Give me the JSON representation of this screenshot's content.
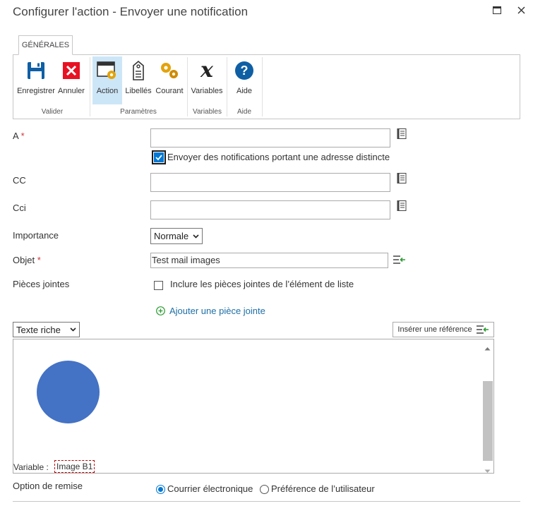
{
  "dialog": {
    "title": "Configurer l'action - Envoyer une notification"
  },
  "ribbon": {
    "tab_label": "GÉNÉRALES",
    "buttons": {
      "save": "Enregistrer",
      "cancel": "Annuler",
      "action": "Action",
      "labels": "Libellés",
      "current": "Courant",
      "variables": "Variables",
      "help": "Aide"
    },
    "groups": {
      "validate": "Valider",
      "parameters": "Paramètres",
      "variables": "Variables",
      "help": "Aide"
    }
  },
  "form": {
    "to_label": "A",
    "required_mark": "*",
    "distinct_checkbox_label": "Envoyer des notifications portant une adresse distincte",
    "distinct_checked": true,
    "cc_label": "CC",
    "bcc_label": "Cci",
    "importance_label": "Importance",
    "importance_value": "Normale",
    "subject_label": "Objet",
    "subject_value": "Test mail images",
    "attachments_label": "Pièces jointes",
    "include_attachments_label": "Inclure les pièces jointes de l’élément de liste",
    "include_attachments_checked": false,
    "add_attachment_link": "Ajouter une pièce jointe",
    "format_value": "Texte riche",
    "insert_reference_button": "Insérer une référence",
    "editor": {
      "variable_label": "Variable :",
      "variable_token": "Image B1",
      "circle_color": "#4472c4"
    },
    "delivery_label": "Option de remise",
    "delivery_options": [
      "Courrier électronique",
      "Préférence de l’utilisateur"
    ],
    "delivery_selected": "Courrier électronique"
  },
  "colors": {
    "accent": "#0078d4",
    "active_button_bg": "#cde6f7",
    "save_icon": "#0f5fa5",
    "cancel_icon": "#e81123",
    "link_green": "#2e9c34"
  }
}
